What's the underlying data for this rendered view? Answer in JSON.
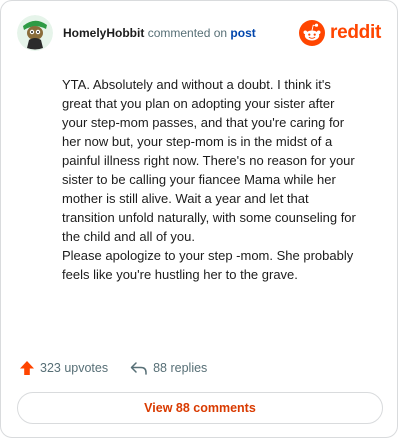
{
  "comment": {
    "username": "HomelyHobbit",
    "action_text": "commented on",
    "post_link": "post",
    "paragraphs": [
      "YTA. Absolutely and without a doubt. I think it's great that you plan on adopting your sister after your step-mom passes, and that you're caring for her now but, your step-mom is in the midst of a painful illness right now. There's no reason for your sister to be calling your fiancee Mama while her mother is still alive. Wait a year and let that transition unfold naturally, with some counseling for the child and all of you.",
      "Please apologize to your step -mom. She probably feels like you're hustling her to the grave."
    ]
  },
  "brand": {
    "wordmark": "reddit",
    "icon": "reddit-snoo-icon",
    "color": "#ff4500"
  },
  "stats": {
    "upvotes": "323 upvotes",
    "replies": "88 replies"
  },
  "actions": {
    "view_comments": "View 88 comments"
  },
  "colors": {
    "upvote": "#ff4500",
    "link": "#0045ac",
    "button_text": "#d93a00",
    "border": "#d9dbdd"
  }
}
